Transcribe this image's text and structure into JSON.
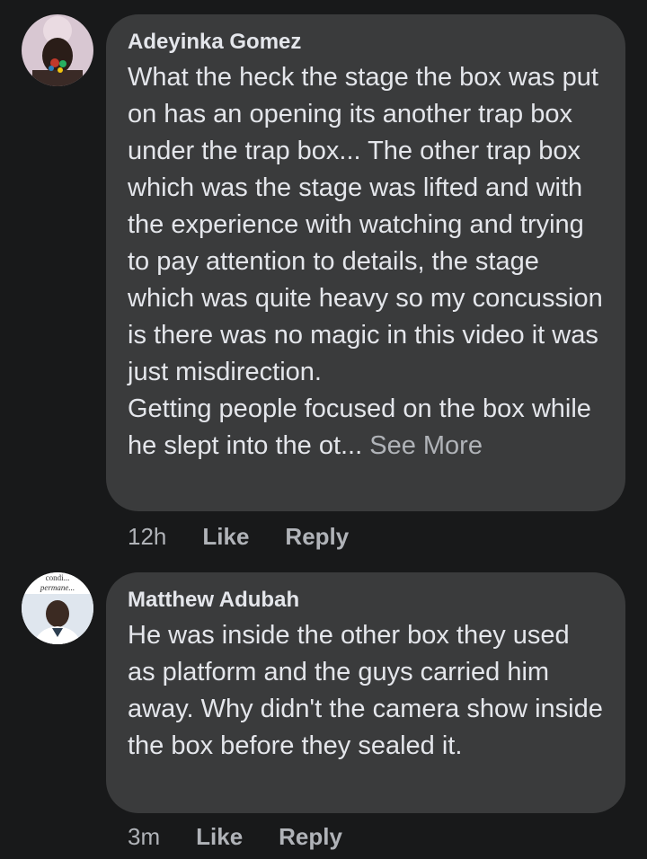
{
  "comments": [
    {
      "author": "Adeyinka Gomez",
      "text": "What the heck the stage the box was put on has an opening its another trap box under the trap box... The other trap box which was the stage was lifted and with the experience with watching and trying to pay attention to details, the stage which was quite heavy so my concussion is there was no magic in this video it was just misdirection.\nGetting people focused on the box while he slept into the ot...",
      "see_more": "See More",
      "time": "12h",
      "like": "Like",
      "reply": "Reply"
    },
    {
      "author": "Matthew Adubah",
      "avatar_caption_top": "condi...",
      "avatar_caption_bottom": "permane...",
      "text": "He was inside the other box they used as platform and the guys carried him away. Why didn't the camera show inside the box before they sealed it.",
      "time": "3m",
      "like": "Like",
      "reply": "Reply"
    }
  ],
  "colors": {
    "background": "#18191a",
    "bubble": "#3a3b3c",
    "text": "#e4e6eb",
    "muted": "#b0b3b8"
  }
}
